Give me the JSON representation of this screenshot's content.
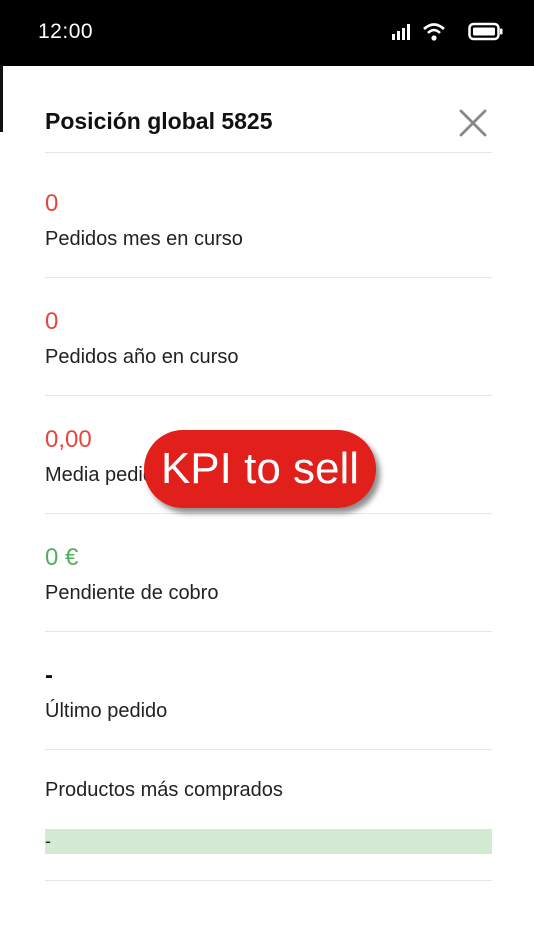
{
  "status_bar": {
    "time": "12:00",
    "icons": [
      "signal-icon",
      "wifi-icon",
      "battery-icon"
    ]
  },
  "panel": {
    "title": "Posición global 5825",
    "close_icon": "close-icon"
  },
  "kpis": [
    {
      "value": "0",
      "label": "Pedidos mes en curso",
      "color": "#e8463a"
    },
    {
      "value": "0",
      "label": "Pedidos año en curso",
      "color": "#e8463a"
    },
    {
      "value": "0,00",
      "label": "Media pedido",
      "color": "#e8463a"
    },
    {
      "value": "0 €",
      "label": "Pendiente de cobro",
      "color": "#52b05c"
    },
    {
      "value": "-",
      "label": "Último pedido",
      "color": "#111111"
    }
  ],
  "products": {
    "heading": "Productos más comprados",
    "rows": [
      "-"
    ],
    "row_color": "#d4ead3"
  },
  "banner": {
    "text": "KPI to sell",
    "color": "#e11f1b"
  }
}
